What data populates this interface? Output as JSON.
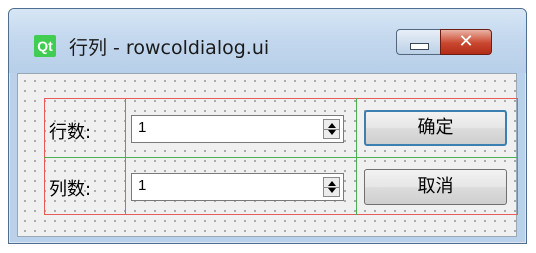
{
  "window": {
    "title": "行列 - rowcoldialog.ui",
    "logo_text": "Qt",
    "minimize_icon": "minimize-icon",
    "close_icon": "close-icon",
    "close_glyph": "✕"
  },
  "form": {
    "rows_label": "行数:",
    "rows_value": "1",
    "cols_label": "列数:",
    "cols_value": "1",
    "ok_label": "确定",
    "cancel_label": "取消"
  },
  "colors": {
    "grid_outline": "#e85b5b",
    "cell_lines": "#4caf50",
    "qt_green": "#41cd52",
    "close_red": "#c9462f",
    "default_button_border": "#3c7fb1"
  }
}
